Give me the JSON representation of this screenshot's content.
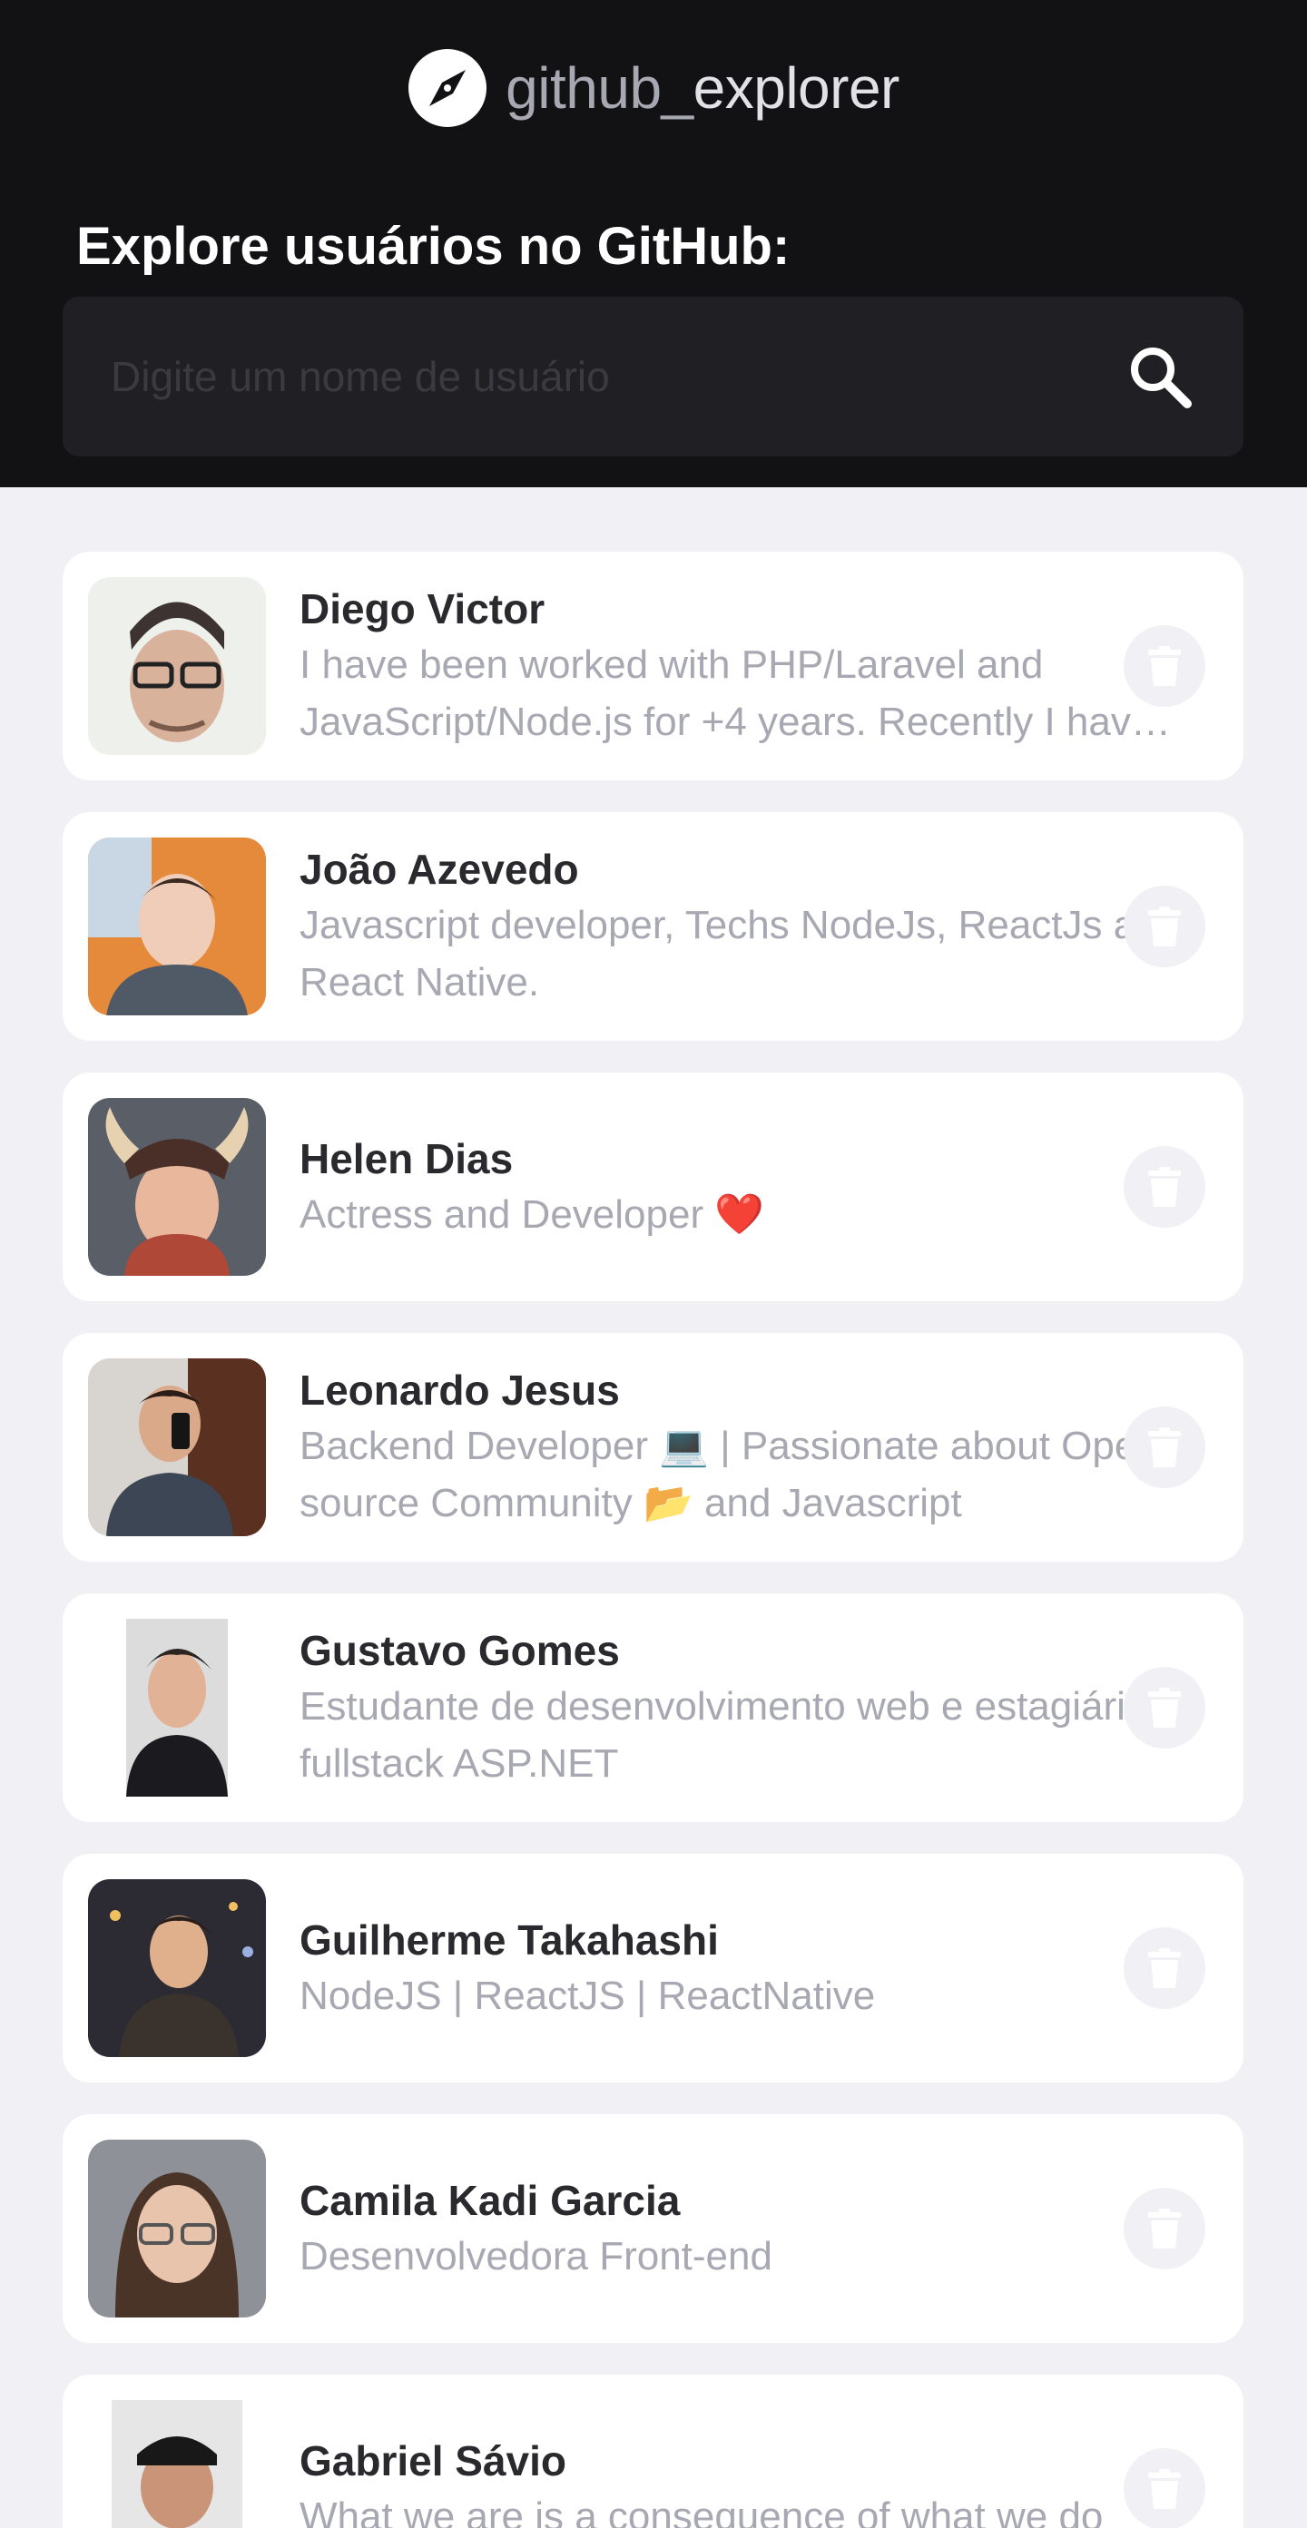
{
  "brand": {
    "part1": "github_",
    "part2": "explorer"
  },
  "header": {
    "title": "Explore usuários no GitHub:"
  },
  "search": {
    "placeholder": "Digite um nome de usuário",
    "value": ""
  },
  "users": [
    {
      "name": "Diego Victor",
      "bio": "I have been worked with PHP/Laravel and JavaScript/Node.js for +4 years. Recently I have been working with React.js and React Native."
    },
    {
      "name": "João Azevedo",
      "bio": "Javascript developer, Techs NodeJs, ReactJs and React Native."
    },
    {
      "name": "Helen Dias",
      "bio": "Actress and Developer ❤️"
    },
    {
      "name": "Leonardo Jesus",
      "bio": "Backend Developer 💻 | Passionate about Open source Community 📂 and Javascript"
    },
    {
      "name": "Gustavo Gomes",
      "bio": "Estudante de desenvolvimento web e estagiário fullstack ASP.NET"
    },
    {
      "name": "Guilherme Takahashi",
      "bio": "NodeJS | ReactJS | ReactNative"
    },
    {
      "name": "Camila Kadi Garcia",
      "bio": "Desenvolvedora Front-end"
    },
    {
      "name": "Gabriel Sávio",
      "bio": "What we are is a consequence of what we do"
    }
  ],
  "icons": {
    "logo": "compass-icon",
    "search": "search-icon",
    "delete": "trash-icon"
  },
  "colors": {
    "header_bg": "#121214",
    "page_bg": "#f0f0f5",
    "card_bg": "#ffffff",
    "name": "#29292e",
    "bio": "#a8a8b3"
  }
}
